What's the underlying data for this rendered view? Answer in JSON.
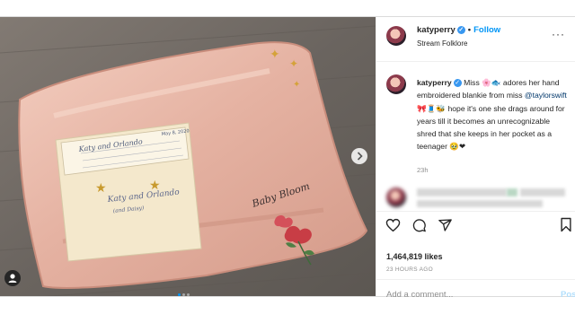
{
  "post": {
    "header": {
      "username": "katyperry",
      "follow_label": "Follow",
      "subtitle": "Stream Folklore"
    },
    "caption": {
      "username": "katyperry",
      "text_1": "Miss 🌸🐟 adores her hand embroidered blankie from miss",
      "mention": "@taylorswift",
      "text_2": "🎀🧵🐝 hope it's one she drags around for years till it becomes an unrecognizable shred that she keeps in her pocket as a teenager 🥹❤",
      "time": "23h"
    },
    "likes": "1,464,819 likes",
    "timestamp": "23 HOURS AGO",
    "comment": {
      "placeholder": "Add a comment...",
      "post_label": "Post"
    },
    "photo": {
      "card_names": "Katy and Orlando",
      "card_date": "May 8, 2020",
      "embroidery": "Baby Bloom"
    }
  },
  "colors": {
    "accent": "#0095f6",
    "floor": "#6f6963",
    "blanket": "#e8b7a8",
    "card": "#f4e8cc"
  }
}
